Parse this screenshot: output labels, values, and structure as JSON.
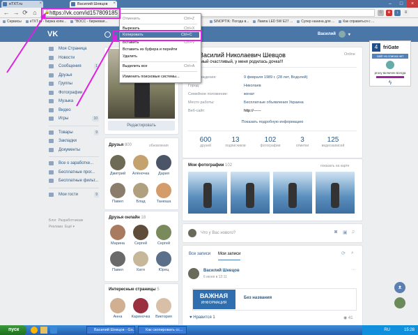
{
  "browser": {
    "tabs": [
      {
        "label": "eTXT.ru"
      },
      {
        "label": "Василий Шевцов"
      }
    ],
    "url": "https://vk.com/id157809185",
    "bookmarks": [
      "Сервисы",
      "eTXT.ru - биржа копи...",
      "\"ВОСС - биржевая...",
      "SINOPTIK: Погода в...",
      "Лампа LED 5W E27 ...",
      "Супер нанина для ...",
      "Как справиться с ..."
    ]
  },
  "context_menu": {
    "items": [
      {
        "label": "Отменить",
        "shortcut": "Ctrl+Z"
      },
      {
        "label": "Вырезать",
        "shortcut": "Ctrl+X"
      },
      {
        "label": "Копировать",
        "shortcut": "Ctrl+C"
      },
      {
        "label": "Вставить",
        "shortcut": "Ctrl+V"
      },
      {
        "label": "Вставить из буфера и перейти",
        "shortcut": ""
      },
      {
        "label": "Удалить",
        "shortcut": ""
      },
      {
        "label": "Выделить все",
        "shortcut": "Ctrl+A"
      },
      {
        "label": "Изменить поисковые системы...",
        "shortcut": ""
      }
    ]
  },
  "vk": {
    "header_user": "Василий",
    "sidebar": [
      {
        "label": "Моя Страница",
        "count": ""
      },
      {
        "label": "Новости",
        "count": ""
      },
      {
        "label": "Сообщения",
        "count": "1"
      },
      {
        "label": "Друзья",
        "count": ""
      },
      {
        "label": "Группы",
        "count": ""
      },
      {
        "label": "Фотографии",
        "count": ""
      },
      {
        "label": "Музыка",
        "count": ""
      },
      {
        "label": "Видео",
        "count": ""
      },
      {
        "label": "Игры",
        "count": "10"
      }
    ],
    "sidebar2": [
      {
        "label": "Товары",
        "count": "9"
      },
      {
        "label": "Закладки",
        "count": ""
      },
      {
        "label": "Документы",
        "count": ""
      }
    ],
    "sidebar3": [
      {
        "label": "Все о заработке...",
        "count": ""
      },
      {
        "label": "Бесплатные прог...",
        "count": ""
      },
      {
        "label": "Бесплатные фильт...",
        "count": ""
      }
    ],
    "sidebar4": [
      {
        "label": "Мои гости",
        "count": "9"
      }
    ],
    "footer": "Блог  Разработчикам\nРеклама  Ещё ▾",
    "edit_button": "Редактировать",
    "friends": {
      "title": "Друзья",
      "count": "800",
      "right": "обновления",
      "people": [
        "Дмитрий",
        "Алёночка",
        "Дария",
        "Павел",
        "Влад",
        "Танюша"
      ]
    },
    "friends_online": {
      "title": "Друзья онлайн",
      "count": "18",
      "people": [
        "Марина",
        "Сергей",
        "Сергей",
        "Павел",
        "Катя",
        "Юрец"
      ]
    },
    "interesting": {
      "title": "Интересные страницы",
      "count": "5",
      "people": [
        "Анна",
        "Кариночка",
        "Виктория"
      ]
    },
    "profile": {
      "name": "Василий Николаевич Шевцов",
      "status": "Самый счастливый, у меня родилась дочка!!!",
      "online": "Online",
      "rows": [
        {
          "label": "День рождения:",
          "value": "9 февраля 1989 г. (28 лет, Водолей)"
        },
        {
          "label": "Город:",
          "value": "Николаев"
        },
        {
          "label": "Семейное положение:",
          "value": "женат"
        },
        {
          "label": "Место работы:",
          "value": "Бесплатные объявления Украина"
        },
        {
          "label": "Веб-сайт:",
          "value": "http://------"
        }
      ],
      "show_more": "Показать подробную информацию",
      "stats": [
        {
          "num": "600",
          "label": "друзей"
        },
        {
          "num": "13",
          "label": "подписчиков"
        },
        {
          "num": "102",
          "label": "фотографии"
        },
        {
          "num": "3",
          "label": "отметки"
        },
        {
          "num": "125",
          "label": "видеозаписей"
        }
      ]
    },
    "photos": {
      "title": "Мои фотографии",
      "count": "102",
      "right": "показать на карте"
    },
    "post_placeholder": "Что у Вас нового?",
    "wall": {
      "tabs": [
        "Все записи",
        "Мои записи"
      ],
      "post_author": "Василий Шевцов",
      "post_date": "6 июня в 12:11",
      "banner_line1": "ВАЖНАЯ",
      "banner_line2": "ИНФОРМАЦИЯ",
      "post_title": "Без названия",
      "likes_label": "Нравится",
      "likes": "1",
      "views": "41"
    }
  },
  "frigate": {
    "title": "friGate",
    "line1": "сайт из списка нет",
    "line2": "proxy включен всегда"
  },
  "taskbar": {
    "start": "пуск",
    "items": [
      "Василий Шевцов - Go...",
      "Как скопировать сс..."
    ],
    "clock": "15:28",
    "lang": "RU"
  },
  "colors": {
    "accent": "#4a76a8",
    "annotation": "#e020e0"
  }
}
